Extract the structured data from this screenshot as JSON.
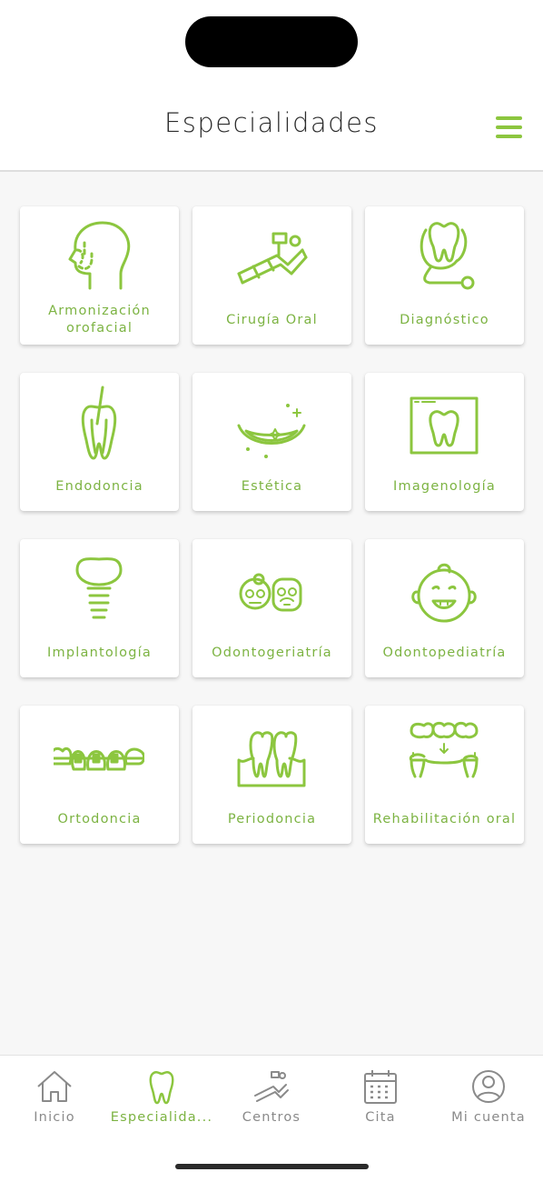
{
  "header": {
    "title": "Especialidades",
    "menu_icon": "hamburger-menu-icon"
  },
  "theme": {
    "accent": "#8cc63f",
    "label_green": "#7cb342",
    "inactive": "#8a8a8a"
  },
  "specialties": [
    {
      "label": "Armonización orofacial",
      "icon": "face-profile-icon"
    },
    {
      "label": "Cirugía Oral",
      "icon": "dental-chair-icon"
    },
    {
      "label": "Diagnóstico",
      "icon": "tooth-stethoscope-icon"
    },
    {
      "label": "Endodoncia",
      "icon": "tooth-root-canal-icon"
    },
    {
      "label": "Estética",
      "icon": "sparkling-smile-icon"
    },
    {
      "label": "Imagenología",
      "icon": "tooth-xray-icon"
    },
    {
      "label": "Implantología",
      "icon": "dental-implant-icon"
    },
    {
      "label": "Odontogeriatría",
      "icon": "elderly-couple-icon"
    },
    {
      "label": "Odontopediatría",
      "icon": "baby-face-icon"
    },
    {
      "label": "Ortodoncia",
      "icon": "braces-icon"
    },
    {
      "label": "Periodoncia",
      "icon": "teeth-gums-icon"
    },
    {
      "label": "Rehabilitación oral",
      "icon": "dental-bridge-icon"
    }
  ],
  "tabs": [
    {
      "label": "Inicio",
      "icon": "home-icon",
      "active": false
    },
    {
      "label": "Especialida...",
      "icon": "tooth-icon",
      "active": true
    },
    {
      "label": "Centros",
      "icon": "dental-chair-icon",
      "active": false
    },
    {
      "label": "Cita",
      "icon": "calendar-icon",
      "active": false
    },
    {
      "label": "Mi cuenta",
      "icon": "user-account-icon",
      "active": false
    }
  ]
}
